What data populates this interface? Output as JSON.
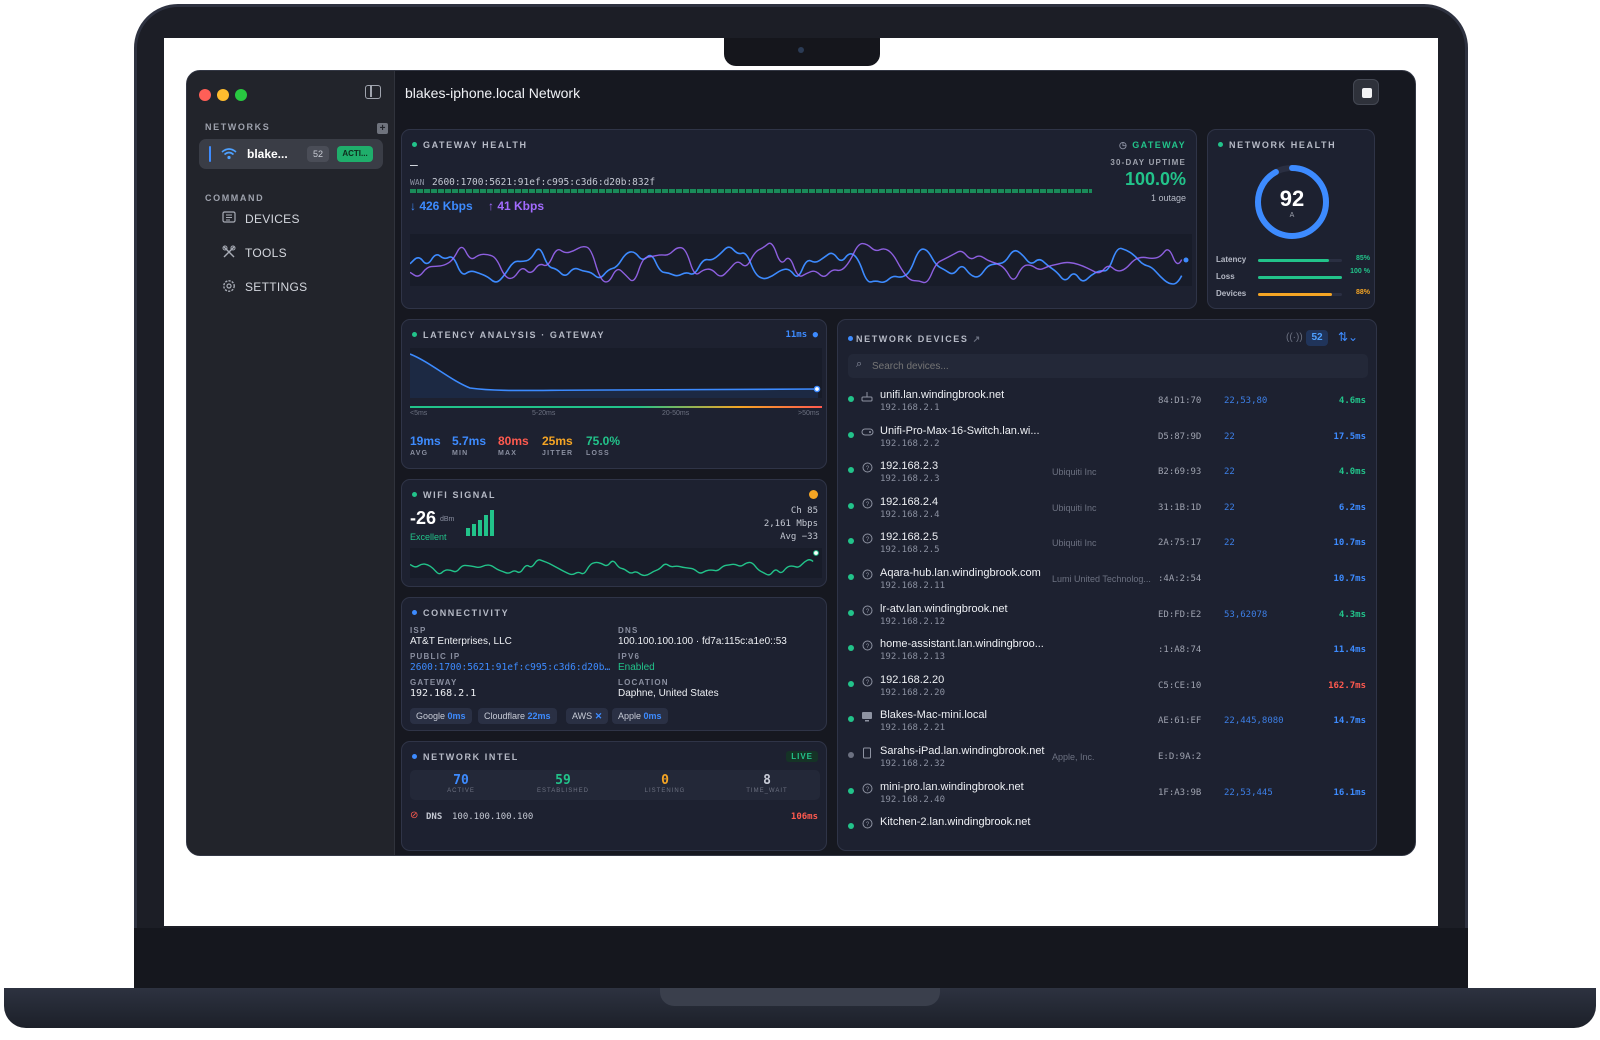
{
  "window": {
    "title": "blakes-iphone.local Network"
  },
  "sidebar": {
    "networks_label": "NETWORKS",
    "network": {
      "name": "blake...",
      "count": "52",
      "status": "ACTI..."
    },
    "command_label": "COMMAND",
    "items": [
      {
        "label": "DEVICES",
        "icon": "devices-icon"
      },
      {
        "label": "TOOLS",
        "icon": "tools-icon"
      },
      {
        "label": "SETTINGS",
        "icon": "settings-icon"
      }
    ]
  },
  "gateway_health": {
    "title": "GATEWAY HEALTH",
    "badge": "GATEWAY",
    "dash": "–",
    "wan_label": "WAN",
    "wan_ip": "2600:1700:5621:91ef:c995:c3d6:d20b:832f",
    "down": "↓ 426 Kbps",
    "up": "↑ 41 Kbps",
    "uptime_label": "30-DAY UPTIME",
    "uptime": "100.0%",
    "outages": "1 outage"
  },
  "network_health": {
    "title": "NETWORK HEALTH",
    "score": "92",
    "score_value": 92,
    "grade": "A",
    "metrics": [
      {
        "label": "Latency",
        "value": "85%",
        "fraction": 0.85,
        "color": "#22c38a"
      },
      {
        "label": "Loss",
        "value": "100 %",
        "fraction": 1.0,
        "color": "#22c38a"
      },
      {
        "label": "Devices",
        "value": "88%",
        "fraction": 0.88,
        "color": "#f5a524"
      }
    ]
  },
  "latency": {
    "title": "LATENCY ANALYSIS · GATEWAY",
    "current": "11ms",
    "scale": [
      "<5ms",
      "5-20ms",
      "20-50ms",
      ">50ms"
    ],
    "stats": [
      {
        "value": "19ms",
        "label": "AVG",
        "color": "#3d8bff"
      },
      {
        "value": "5.7ms",
        "label": "MIN",
        "color": "#3d8bff"
      },
      {
        "value": "80ms",
        "label": "MAX",
        "color": "#ff5a4f"
      },
      {
        "value": "25ms",
        "label": "JITTER",
        "color": "#f5a524"
      },
      {
        "value": "75.0%",
        "label": "LOSS",
        "color": "#22c38a"
      }
    ]
  },
  "wifi": {
    "title": "WIFI SIGNAL",
    "dbm": "-26",
    "unit": "dBm",
    "quality": "Excellent",
    "channel": "Ch 85",
    "rate": "2,161 Mbps",
    "avg": "Avg −33"
  },
  "connectivity": {
    "title": "CONNECTIVITY",
    "isp_label": "ISP",
    "isp": "AT&T Enterprises, LLC",
    "dns_label": "DNS",
    "dns": "100.100.100.100 · fd7a:115c:a1e0::53",
    "publicip_label": "PUBLIC IP",
    "publicip": "2600:1700:5621:91ef:c995:c3d6:d20b…",
    "ipv6_label": "IPV6",
    "ipv6": "Enabled",
    "gateway_label": "GATEWAY",
    "gateway": "192.168.2.1",
    "location_label": "LOCATION",
    "location": "Daphne, United States",
    "pills": [
      {
        "name": "Google",
        "value": "0ms"
      },
      {
        "name": "Cloudflare",
        "value": "22ms"
      },
      {
        "name": "AWS",
        "value": "✕"
      },
      {
        "name": "Apple",
        "value": "0ms"
      }
    ]
  },
  "intel": {
    "title": "NETWORK INTEL",
    "badge": "LIVE",
    "stats": [
      {
        "value": "70",
        "label": "ACTIVE",
        "color": "#3d8bff"
      },
      {
        "value": "59",
        "label": "ESTABLISHED",
        "color": "#22c38a"
      },
      {
        "value": "0",
        "label": "LISTENING",
        "color": "#f5a524"
      },
      {
        "value": "8",
        "label": "TIME_WAIT",
        "color": "#c7cbd6"
      }
    ],
    "dns_label": "DNS",
    "dns_ip": "100.100.100.100",
    "dns_ms": "106ms"
  },
  "devices": {
    "title": "NETWORK DEVICES",
    "count": "52",
    "search_placeholder": "Search devices...",
    "rows": [
      {
        "name": "unifi.lan.windingbrook.net",
        "ip": "192.168.2.1",
        "vendor": "",
        "mac": "84:D1:70",
        "ports": "22,53,80",
        "latency": "4.6ms",
        "lat_color": "#22c38a",
        "icon": "router-icon",
        "status": "#22c38a"
      },
      {
        "name": "Unifi-Pro-Max-16-Switch.lan.wi...",
        "ip": "192.168.2.2",
        "vendor": "",
        "mac": "D5:87:9D",
        "ports": "22",
        "latency": "17.5ms",
        "lat_color": "#3d8bff",
        "icon": "gamepad-icon",
        "status": "#22c38a"
      },
      {
        "name": "192.168.2.3",
        "ip": "192.168.2.3",
        "vendor": "Ubiquiti Inc",
        "mac": "B2:69:93",
        "ports": "22",
        "latency": "4.0ms",
        "lat_color": "#22c38a",
        "icon": "unknown-icon",
        "status": "#22c38a"
      },
      {
        "name": "192.168.2.4",
        "ip": "192.168.2.4",
        "vendor": "Ubiquiti Inc",
        "mac": "31:1B:1D",
        "ports": "22",
        "latency": "6.2ms",
        "lat_color": "#3d8bff",
        "icon": "unknown-icon",
        "status": "#22c38a"
      },
      {
        "name": "192.168.2.5",
        "ip": "192.168.2.5",
        "vendor": "Ubiquiti Inc",
        "mac": "2A:75:17",
        "ports": "22",
        "latency": "10.7ms",
        "lat_color": "#3d8bff",
        "icon": "unknown-icon",
        "status": "#22c38a"
      },
      {
        "name": "Aqara-hub.lan.windingbrook.com",
        "ip": "192.168.2.11",
        "vendor": "Lumi United Technolog...",
        "mac": ":4A:2:54",
        "ports": "",
        "latency": "10.7ms",
        "lat_color": "#3d8bff",
        "icon": "unknown-icon",
        "status": "#22c38a"
      },
      {
        "name": "lr-atv.lan.windingbrook.net",
        "ip": "192.168.2.12",
        "vendor": "",
        "mac": "ED:FD:E2",
        "ports": "53,62078",
        "latency": "4.3ms",
        "lat_color": "#22c38a",
        "icon": "unknown-icon",
        "status": "#22c38a"
      },
      {
        "name": "home-assistant.lan.windingbroo...",
        "ip": "192.168.2.13",
        "vendor": "",
        "mac": ":1:A8:74",
        "ports": "",
        "latency": "11.4ms",
        "lat_color": "#3d8bff",
        "icon": "unknown-icon",
        "status": "#22c38a"
      },
      {
        "name": "192.168.2.20",
        "ip": "192.168.2.20",
        "vendor": "",
        "mac": "C5:CE:10",
        "ports": "",
        "latency": "162.7ms",
        "lat_color": "#ff5a4f",
        "icon": "unknown-icon",
        "status": "#22c38a"
      },
      {
        "name": "Blakes-Mac-mini.local",
        "ip": "192.168.2.21",
        "vendor": "",
        "mac": "AE:61:EF",
        "ports": "22,445,8080",
        "latency": "14.7ms",
        "lat_color": "#3d8bff",
        "icon": "desktop-icon",
        "status": "#22c38a"
      },
      {
        "name": "Sarahs-iPad.lan.windingbrook.net",
        "ip": "192.168.2.32",
        "vendor": "Apple, Inc.",
        "mac": "E:D:9A:2",
        "ports": "",
        "latency": "",
        "lat_color": "#3d8bff",
        "icon": "tablet-icon",
        "status": "#6c7181"
      },
      {
        "name": "mini-pro.lan.windingbrook.net",
        "ip": "192.168.2.40",
        "vendor": "",
        "mac": "1F:A3:9B",
        "ports": "22,53,445",
        "latency": "16.1ms",
        "lat_color": "#3d8bff",
        "icon": "unknown-icon",
        "status": "#22c38a"
      },
      {
        "name": "Kitchen-2.lan.windingbrook.net",
        "ip": "",
        "vendor": "",
        "mac": "",
        "ports": "",
        "latency": "",
        "lat_color": "#3d8bff",
        "icon": "unknown-icon",
        "status": "#22c38a"
      }
    ]
  }
}
